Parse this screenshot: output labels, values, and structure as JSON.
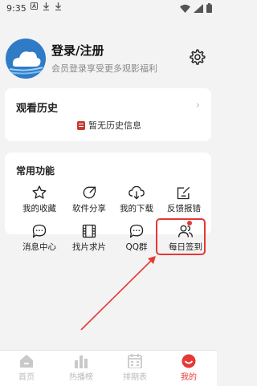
{
  "status_bar": {
    "time": "9:35"
  },
  "profile": {
    "title": "登录/注册",
    "subtitle": "会员登录享受更多观影福利"
  },
  "history": {
    "title": "观看历史",
    "empty_text": "暂无历史信息"
  },
  "functions": {
    "title": "常用功能",
    "items": [
      {
        "label": "我的收藏",
        "icon": "star-icon"
      },
      {
        "label": "软件分享",
        "icon": "share-icon"
      },
      {
        "label": "我的下载",
        "icon": "cloud-download-icon"
      },
      {
        "label": "反馈报错",
        "icon": "edit-icon"
      },
      {
        "label": "消息中心",
        "icon": "chat-icon"
      },
      {
        "label": "找片求片",
        "icon": "film-search-icon"
      },
      {
        "label": "QQ群",
        "icon": "qq-chat-icon"
      },
      {
        "label": "每日签到",
        "icon": "users-icon"
      }
    ]
  },
  "tabs": [
    {
      "label": "首页",
      "icon": "home-icon"
    },
    {
      "label": "热播榜",
      "icon": "bar-chart-icon"
    },
    {
      "label": "排期表",
      "icon": "calendar-icon"
    },
    {
      "label": "我的",
      "icon": "profile-icon",
      "active": true
    }
  ],
  "colors": {
    "accent": "#e53935",
    "avatar_blue": "#2f7bc6",
    "background": "#f3f3f3"
  }
}
